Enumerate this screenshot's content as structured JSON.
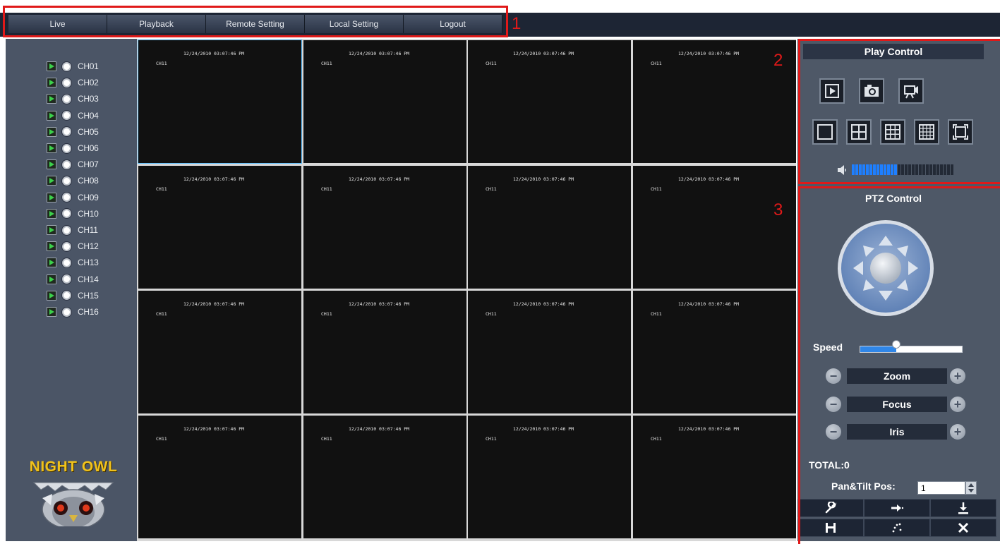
{
  "nav": {
    "items": [
      "Live",
      "Playback",
      "Remote Setting",
      "Local Setting",
      "Logout"
    ]
  },
  "callouts": [
    "1",
    "2",
    "3"
  ],
  "channels": [
    "CH01",
    "CH02",
    "CH03",
    "CH04",
    "CH05",
    "CH06",
    "CH07",
    "CH08",
    "CH09",
    "CH10",
    "CH11",
    "CH12",
    "CH13",
    "CH14",
    "CH15",
    "CH16"
  ],
  "logo": {
    "text": "NIGHT OWL"
  },
  "tiles": {
    "datetime": "12/24/2010 03:07:46 PM",
    "channel": "CH11"
  },
  "play_control": {
    "title": "Play Control",
    "volume_level": 0.45
  },
  "ptz": {
    "title": "PTZ Control",
    "speed_label": "Speed",
    "speed_value": 0.35,
    "zoom_label": "Zoom",
    "focus_label": "Focus",
    "iris_label": "Iris",
    "total_label": "TOTAL:0",
    "pos_label": "Pan&Tilt Pos:",
    "pos_value": "1"
  },
  "icons": {
    "play": "play-icon",
    "snapshot": "camera-icon",
    "record": "record-icon",
    "layout1": "single-view-icon",
    "layout4": "quad-view-icon",
    "layout9": "nine-view-icon",
    "layout16": "sixteen-view-icon",
    "fullscreen": "fullscreen-icon",
    "volume": "volume-icon",
    "tools": [
      "wrench-icon",
      "goto-icon",
      "download-icon",
      "save-icon",
      "cruise-icon",
      "delete-icon"
    ]
  },
  "colors": {
    "accent_red": "#e01919",
    "panel": "#4e5867",
    "logo_yellow": "#f1c21b",
    "speed_blue": "#2f86e8"
  }
}
